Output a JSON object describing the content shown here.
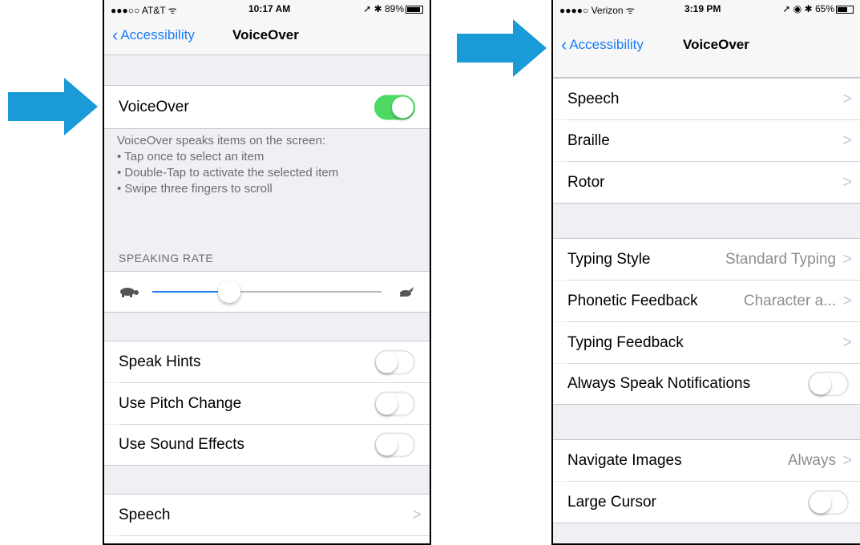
{
  "colors": {
    "accent": "#1a7cf9",
    "toggle_on": "#4cd964",
    "arrow": "#1a9ad6"
  },
  "left_phone": {
    "status": {
      "carrier": "●●●○○ AT&T ᯤ",
      "time": "10:17 AM",
      "right": "➚ ✱ 89%",
      "battery_percent": 89
    },
    "nav": {
      "back_label": "Accessibility",
      "title": "VoiceOver"
    },
    "voiceover_row": {
      "label": "VoiceOver",
      "toggle_on": true
    },
    "description": [
      "VoiceOver speaks items on the screen:",
      "• Tap once to select an item",
      "• Double-Tap to activate the selected item",
      "• Swipe three fingers to scroll"
    ],
    "speaking_rate": {
      "header": "SPEAKING RATE",
      "value_fraction": 0.2,
      "slow_icon": "turtle-icon",
      "fast_icon": "hare-icon"
    },
    "toggles": [
      {
        "label": "Speak Hints",
        "on": false
      },
      {
        "label": "Use Pitch Change",
        "on": false
      },
      {
        "label": "Use Sound Effects",
        "on": false
      }
    ],
    "speech_row": {
      "label": "Speech"
    }
  },
  "right_phone": {
    "status": {
      "carrier": "●●●●○ Verizon ᯤ",
      "time": "3:19 PM",
      "right": "➚ ◉ ✱ 65%",
      "battery_percent": 65
    },
    "nav": {
      "back_label": "Accessibility",
      "title": "VoiceOver"
    },
    "group1": [
      {
        "label": "Speech"
      },
      {
        "label": "Braille"
      },
      {
        "label": "Rotor"
      }
    ],
    "typing_style": {
      "label": "Typing Style",
      "value": "Standard Typing"
    },
    "phonetic_feedback": {
      "label": "Phonetic Feedback",
      "value": "Character a..."
    },
    "typing_feedback": {
      "label": "Typing Feedback"
    },
    "always_speak": {
      "label": "Always Speak Notifications",
      "on": false
    },
    "navigate_images": {
      "label": "Navigate Images",
      "value": "Always"
    },
    "large_cursor": {
      "label": "Large Cursor",
      "on": false
    }
  },
  "chevron_glyph": ">"
}
